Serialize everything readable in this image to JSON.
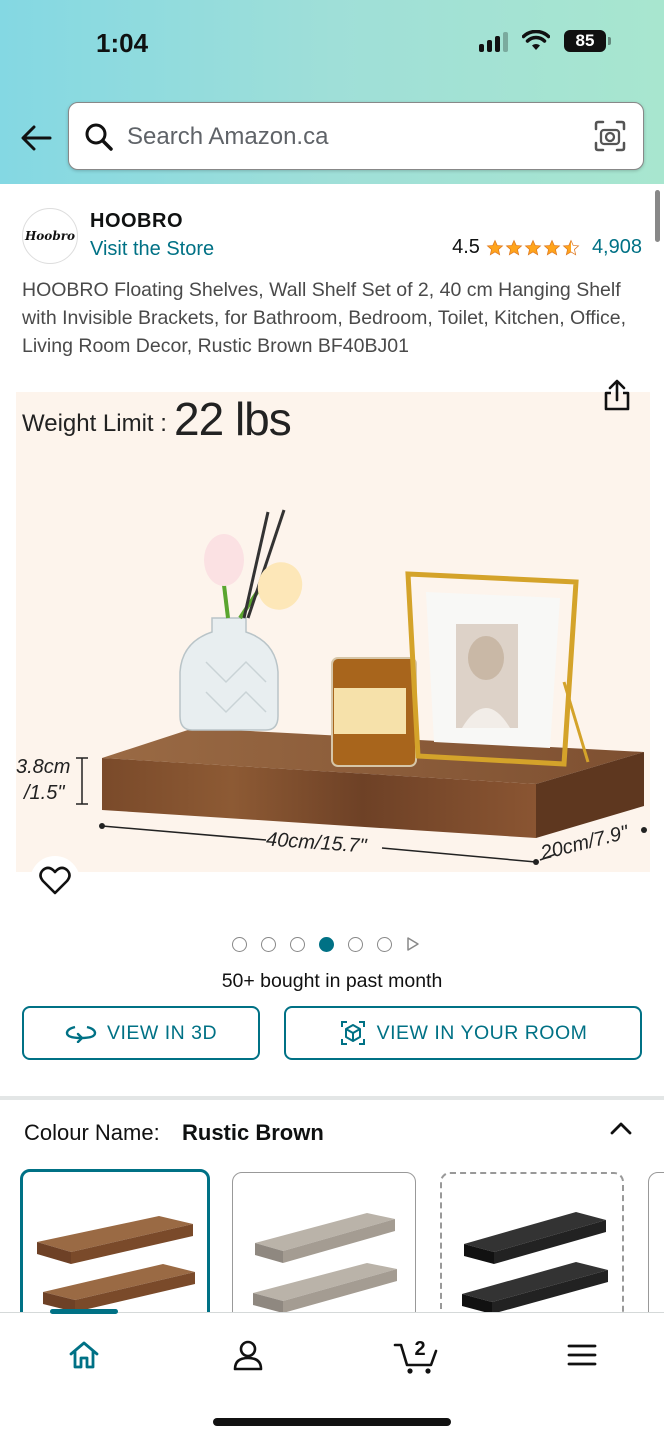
{
  "status_bar": {
    "time": "1:04",
    "battery": "85"
  },
  "search": {
    "placeholder": "Search Amazon.ca"
  },
  "product": {
    "brand": "HOOBRO",
    "brand_logo_text": "Hoobro",
    "store_link": "Visit the Store",
    "rating": "4.5",
    "rating_count": "4,908",
    "title": "HOOBRO Floating Shelves, Wall Shelf Set of 2, 40 cm Hanging Shelf with Invisible Brackets, for Bathroom, Bedroom, Toilet, Kitchen, Office, Living Room Decor, Rustic Brown BF40BJ01",
    "image": {
      "weight_label": "Weight Limit :",
      "weight_value": "22 lbs",
      "height_dim_1": "3.8cm",
      "height_dim_2": "/1.5\"",
      "length_dim": "40cm/15.7\"",
      "depth_dim": "20cm/7.9\""
    },
    "carousel": {
      "total_dots": 6,
      "active_index": 3
    },
    "bought_text": "50+ bought in past month",
    "view_3d_label": "VIEW IN 3D",
    "view_room_label": "VIEW IN YOUR ROOM",
    "colour": {
      "label": "Colour Name:",
      "value": "Rustic Brown",
      "swatches": [
        "Rustic Brown",
        "Grey",
        "Black"
      ]
    }
  },
  "tabbar": {
    "items": [
      "home",
      "account",
      "cart",
      "menu"
    ],
    "cart_count": "2"
  },
  "colors": {
    "accent": "#007185",
    "star": "#ffa41c"
  },
  "icons": [
    "back-arrow-icon",
    "search-icon",
    "camera-icon",
    "share-icon",
    "heart-icon",
    "rotate-3d-icon",
    "ar-cube-icon",
    "chevron-up-icon",
    "home-icon",
    "account-icon",
    "cart-icon",
    "menu-icon"
  ]
}
